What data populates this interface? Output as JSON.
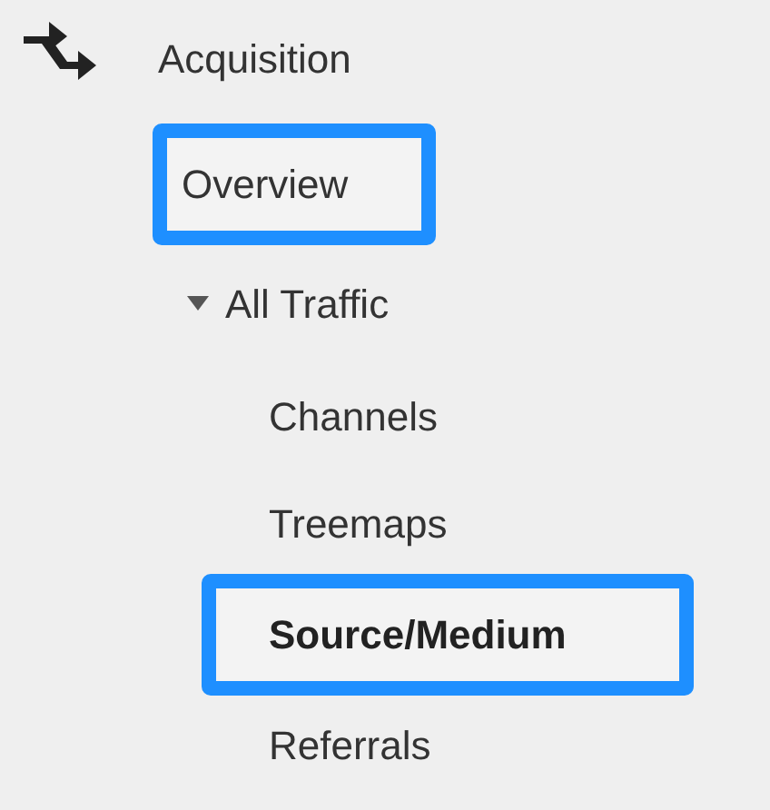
{
  "section": {
    "title": "Acquisition",
    "items": [
      {
        "label": "Overview",
        "highlighted": true,
        "selected": false
      },
      {
        "label": "All Traffic",
        "expanded": true,
        "children": [
          {
            "label": "Channels",
            "highlighted": false,
            "selected": false
          },
          {
            "label": "Treemaps",
            "highlighted": false,
            "selected": false
          },
          {
            "label": "Source/Medium",
            "highlighted": true,
            "selected": true
          },
          {
            "label": "Referrals",
            "highlighted": false,
            "selected": false
          }
        ]
      }
    ]
  }
}
